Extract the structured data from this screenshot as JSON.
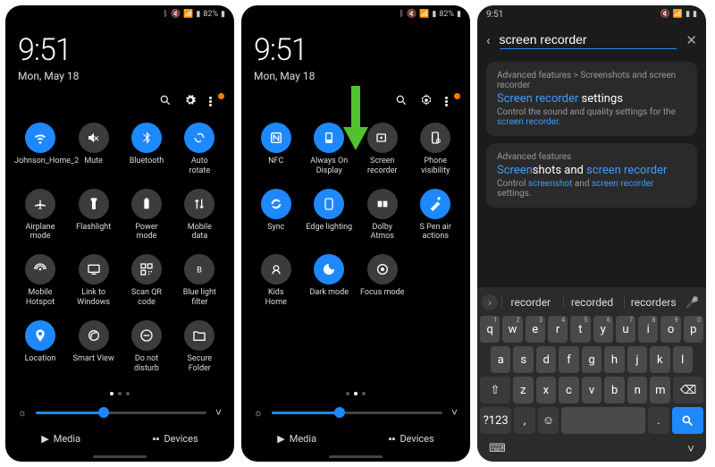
{
  "status": {
    "time": "9:51",
    "battery": "82%",
    "icons": [
      "bt-icon",
      "mute-icon",
      "signal-icon",
      "wifi-icon",
      "battery-icon"
    ]
  },
  "clock": {
    "time": "9:51",
    "date": "Mon, May 18"
  },
  "panel1": {
    "tiles": [
      {
        "id": "wifi",
        "label": "Johnson_Home_2",
        "active": true
      },
      {
        "id": "mute",
        "label": "Mute",
        "active": false
      },
      {
        "id": "bluetooth",
        "label": "Bluetooth",
        "active": true
      },
      {
        "id": "auto-rotate",
        "label": "Auto\nrotate",
        "active": true
      },
      {
        "id": "airplane",
        "label": "Airplane\nmode",
        "active": false
      },
      {
        "id": "flashlight",
        "label": "Flashlight",
        "active": false
      },
      {
        "id": "power-mode",
        "label": "Power\nmode",
        "active": false
      },
      {
        "id": "mobile-data",
        "label": "Mobile\ndata",
        "active": false
      },
      {
        "id": "hotspot",
        "label": "Mobile\nHotspot",
        "active": false
      },
      {
        "id": "link-windows",
        "label": "Link to\nWindows",
        "active": false
      },
      {
        "id": "scan-qr",
        "label": "Scan QR\ncode",
        "active": false
      },
      {
        "id": "blue-light",
        "label": "Blue light\nfilter",
        "active": false
      },
      {
        "id": "location",
        "label": "Location",
        "active": true
      },
      {
        "id": "smart-view",
        "label": "Smart View",
        "active": false
      },
      {
        "id": "dnd",
        "label": "Do not\ndisturb",
        "active": false
      },
      {
        "id": "secure-folder",
        "label": "Secure\nFolder",
        "active": false
      }
    ],
    "brightness": 0.4,
    "pager_total": 3,
    "pager_on": 0,
    "footer": {
      "media": "Media",
      "devices": "Devices"
    }
  },
  "panel2": {
    "tiles": [
      {
        "id": "nfc",
        "label": "NFC",
        "active": true
      },
      {
        "id": "always-on",
        "label": "Always On\nDisplay",
        "active": true
      },
      {
        "id": "screen-recorder",
        "label": "Screen\nrecorder",
        "active": false
      },
      {
        "id": "phone-visibility",
        "label": "Phone\nvisibility",
        "active": false
      },
      {
        "id": "sync",
        "label": "Sync",
        "active": true
      },
      {
        "id": "edge-lighting",
        "label": "Edge lighting",
        "active": true
      },
      {
        "id": "dolby-atmos",
        "label": "Dolby\nAtmos",
        "active": false
      },
      {
        "id": "spen-air",
        "label": "S Pen air\nactions",
        "active": true
      },
      {
        "id": "kids-home",
        "label": "Kids\nHome",
        "active": false
      },
      {
        "id": "dark-mode",
        "label": "Dark mode",
        "active": true
      },
      {
        "id": "focus-mode",
        "label": "Focus mode",
        "active": false
      }
    ],
    "brightness": 0.4,
    "pager_total": 3,
    "pager_on": 1
  },
  "panel3": {
    "search": {
      "query": "screen recorder"
    },
    "results": [
      {
        "crumb": "Advanced features > Screenshots and screen recorder",
        "title_pre": "Screen recorder",
        "title_rest": " settings",
        "desc_pre": "Control the sound and quality settings for the ",
        "desc_hl": "screen recorder",
        "desc_post": "."
      },
      {
        "crumb": "Advanced features",
        "title_pre": "Screen",
        "title_mid": "shots and ",
        "title_hl2": "screen recorder",
        "desc_pre": "Control ",
        "desc_hl": "screenshot",
        "desc_mid": " and ",
        "desc_hl2": "screen recorder",
        "desc_post": " settings."
      }
    ],
    "suggestions": [
      "recorder",
      "recorded",
      "recorders"
    ],
    "keyboard": {
      "row1": [
        "q",
        "w",
        "e",
        "r",
        "t",
        "y",
        "u",
        "i",
        "o",
        "p"
      ],
      "row1num": [
        "1",
        "2",
        "3",
        "4",
        "5",
        "6",
        "7",
        "8",
        "9",
        "0"
      ],
      "row2": [
        "a",
        "s",
        "d",
        "f",
        "g",
        "h",
        "j",
        "k",
        "l"
      ],
      "row3": [
        "z",
        "x",
        "c",
        "v",
        "b",
        "n",
        "m"
      ],
      "shift": "⇧",
      "back": "⌫",
      "sym": "?123",
      "comma": ",",
      "period": ".",
      "search": "🔍",
      "emoji": "☺"
    }
  }
}
